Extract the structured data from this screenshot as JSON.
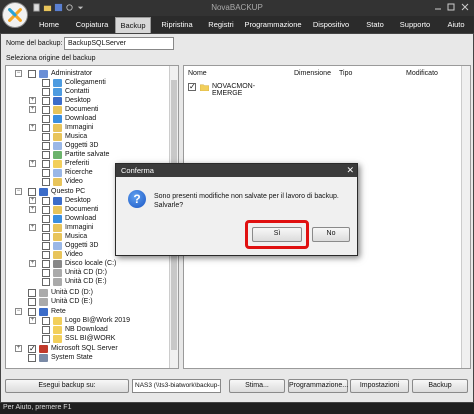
{
  "window": {
    "title": "NovaBACKUP",
    "help_label": "Aiuto"
  },
  "ribbon": {
    "tabs": [
      "Home",
      "Copiatura",
      "Backup",
      "Ripristina",
      "Registri",
      "Programmazione",
      "Dispositivo",
      "Stato",
      "Supporto"
    ],
    "active_tab": "Backup"
  },
  "backup": {
    "name_label": "Nome del backup:",
    "name_value": "BackupSQLServer",
    "source_label": "Seleziona origine del backup"
  },
  "tree": {
    "nodes": [
      {
        "label": "Administrator",
        "icon": "user-icon",
        "checked": false
      },
      {
        "label": "Collegamenti",
        "icon": "links-icon",
        "checked": false
      },
      {
        "label": "Contatti",
        "icon": "contacts-icon",
        "checked": false
      },
      {
        "label": "Desktop",
        "icon": "desktop-icon",
        "checked": false
      },
      {
        "label": "Documenti",
        "icon": "documents-icon",
        "checked": false
      },
      {
        "label": "Download",
        "icon": "download-icon",
        "checked": false
      },
      {
        "label": "Immagini",
        "icon": "images-icon",
        "checked": false
      },
      {
        "label": "Musica",
        "icon": "music-icon",
        "checked": false
      },
      {
        "label": "Oggetti 3D",
        "icon": "objects-3d-icon",
        "checked": false
      },
      {
        "label": "Partite salvate",
        "icon": "saved-games-icon",
        "checked": false
      },
      {
        "label": "Preferiti",
        "icon": "favorites-icon",
        "checked": false
      },
      {
        "label": "Ricerche",
        "icon": "search-icon",
        "checked": false
      },
      {
        "label": "Video",
        "icon": "video-icon",
        "checked": false
      },
      {
        "label": "Questo PC",
        "icon": "computer-icon",
        "checked": false
      },
      {
        "label": "Desktop",
        "icon": "desktop-icon",
        "checked": false
      },
      {
        "label": "Documenti",
        "icon": "documents-icon",
        "checked": false
      },
      {
        "label": "Download",
        "icon": "download-icon",
        "checked": false
      },
      {
        "label": "Immagini",
        "icon": "images-icon",
        "checked": false
      },
      {
        "label": "Musica",
        "icon": "music-icon",
        "checked": false
      },
      {
        "label": "Oggetti 3D",
        "icon": "objects-3d-icon",
        "checked": false
      },
      {
        "label": "Video",
        "icon": "video-icon",
        "checked": false
      },
      {
        "label": "Disco locale (C:)",
        "icon": "drive-icon",
        "checked": false
      },
      {
        "label": "Unità CD (D:)",
        "icon": "cd-drive-icon",
        "checked": false
      },
      {
        "label": "Unità CD (E:)",
        "icon": "cd-drive-icon",
        "checked": false
      },
      {
        "label": "Unità CD (D:)",
        "icon": "cd-drive-icon",
        "checked": false
      },
      {
        "label": "Unità CD (E:)",
        "icon": "cd-drive-icon",
        "checked": false
      },
      {
        "label": "Rete",
        "icon": "network-icon",
        "checked": false
      },
      {
        "label": "Logo BI@Work 2019",
        "icon": "folder-icon",
        "checked": false
      },
      {
        "label": "NB Download",
        "icon": "folder-icon",
        "checked": false
      },
      {
        "label": "SSL BI@WORK",
        "icon": "folder-icon",
        "checked": false
      },
      {
        "label": "Microsoft SQL Server",
        "icon": "sql-server-icon",
        "checked": true
      },
      {
        "label": "System State",
        "icon": "system-state-icon",
        "checked": false
      }
    ]
  },
  "file_list": {
    "columns": [
      "Nome",
      "Dimensione",
      "Tipo",
      "Modificato"
    ],
    "rows": [
      {
        "name": "NOVACMON-EMERGE",
        "checked": true
      }
    ]
  },
  "bottom_bar": {
    "run_backup_label": "Esegui backup su:",
    "destination_value": "NAS3 (\\\\ts3-biatwork\\backup-novabackup\\",
    "buttons": [
      "Stima...",
      "Programmazione...",
      "Impostazioni",
      "Backup"
    ]
  },
  "status_bar": {
    "text": "Per Aiuto, premere F1"
  },
  "dialog": {
    "title": "Conferma",
    "message": "Sono presenti modifiche non salvate per il lavoro di backup. Salvarle?",
    "yes_label": "Sì",
    "no_label": "No",
    "highlight_color": "#e01010"
  }
}
